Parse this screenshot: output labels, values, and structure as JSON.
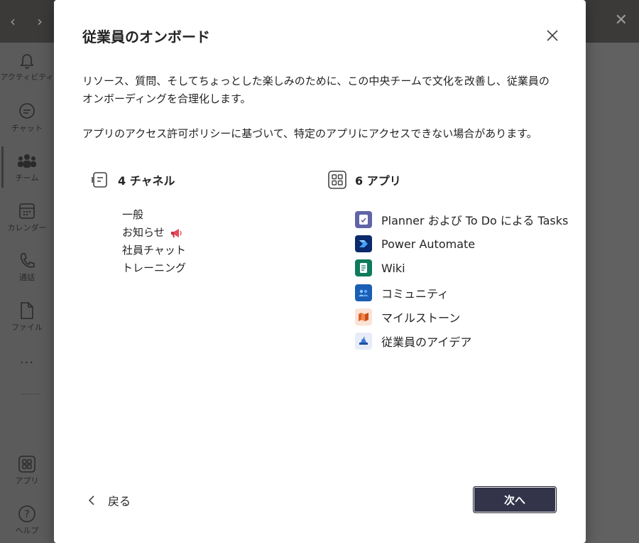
{
  "background": {
    "rail_items": [
      {
        "label": "アクティビティ",
        "icon": "bell-icon"
      },
      {
        "label": "チャット",
        "icon": "chat-icon"
      },
      {
        "label": "チーム",
        "icon": "teams-icon"
      },
      {
        "label": "カレンダー",
        "icon": "calendar-icon"
      },
      {
        "label": "通話",
        "icon": "phone-icon"
      },
      {
        "label": "ファイル",
        "icon": "file-icon"
      },
      {
        "label": "アプリ",
        "icon": "apps-icon"
      },
      {
        "label": "ヘルプ",
        "icon": "help-icon"
      }
    ],
    "more_label": "···"
  },
  "dialog": {
    "title": "従業員のオンボード",
    "description": "リソース、質問、そしてちょっとした楽しみのために、この中央チームで文化を改善し、従業員のオンボーディングを合理化します。",
    "note": "アプリのアクセス許可ポリシーに基づいて、特定のアプリにアクセスできない場合があります。",
    "channels": {
      "heading": "4 チャネル",
      "items": [
        "一般",
        "お知らせ",
        "社員チャット",
        "トレーニング"
      ]
    },
    "apps": {
      "heading": "6 アプリ",
      "items": [
        {
          "label": "Planner および To Do による Tasks",
          "icon": "planner-icon",
          "color": "#6264a7"
        },
        {
          "label": "Power Automate",
          "icon": "power-automate-icon",
          "color": "#0b2a6b"
        },
        {
          "label": "Wiki",
          "icon": "wiki-icon",
          "color": "#0f7b5c"
        },
        {
          "label": "コミュニティ",
          "icon": "community-icon",
          "color": "#1a5fb4"
        },
        {
          "label": "マイルストーン",
          "icon": "milestones-icon",
          "color": "#fbe3d6"
        },
        {
          "label": "従業員のアイデア",
          "icon": "employee-ideas-icon",
          "color": "#e6edf8"
        }
      ]
    },
    "back_label": "戻る",
    "next_label": "次へ"
  }
}
